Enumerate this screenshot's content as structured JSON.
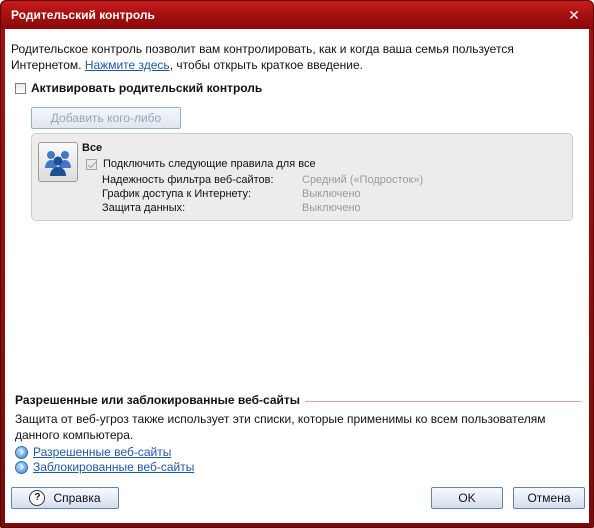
{
  "window": {
    "title": "Родительский контроль",
    "close_glyph": "✕"
  },
  "intro": {
    "text_before": "Родительское контроль позволит вам контролировать, как и когда ваша семья пользуется Интернетом.",
    "link": "Нажмите здесь",
    "text_after": ", чтобы открыть краткое введение."
  },
  "activate": {
    "label": "Активировать родительский контроль",
    "checked": false
  },
  "add_button": {
    "label": "Добавить кого-либо"
  },
  "profile": {
    "icon": "users-icon",
    "name": "Все",
    "rules_checkbox_label": "Подключить следующие правила для все",
    "rules": [
      {
        "name": "Надежность фильтра веб-сайтов:",
        "value": "Средний («Подросток»)"
      },
      {
        "name": "График доступа к Интернету:",
        "value": "Выключено"
      },
      {
        "name": "Защита данных:",
        "value": "Выключено"
      }
    ]
  },
  "websites": {
    "title": "Разрешенные или заблокированные веб-сайты",
    "description": "Защита от веб-угроз также использует эти списки, которые применимы ко всем пользователям данного компьютера.",
    "links": [
      {
        "label": "Разрешенные веб-сайты",
        "icon": "arrow-circle-icon"
      },
      {
        "label": "Заблокированные веб-сайты",
        "icon": "arrow-circle-icon"
      }
    ]
  },
  "buttons": {
    "help": "Справка",
    "help_icon": "?",
    "ok": "OK",
    "cancel": "Отмена"
  },
  "colors": {
    "titlebar": "#a20f0f",
    "link": "#1f57a8"
  }
}
